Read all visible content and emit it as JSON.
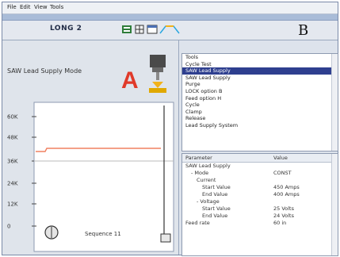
{
  "menu": [
    "File",
    "Edit",
    "View",
    "Tools"
  ],
  "toolbar": {
    "device_label": "LONG 2"
  },
  "callouts": {
    "a": "A",
    "b": "B"
  },
  "device_name": "SAW Lead Supply Mode",
  "chart_data": {
    "type": "line",
    "y_tick_labels": [
      "60K",
      "48K",
      "36K",
      "24K",
      "12K",
      "0"
    ],
    "status_text": "Sequence 11",
    "series_color": "#f08060"
  },
  "tree": {
    "items": [
      {
        "label": "Tools"
      },
      {
        "label": "Cycle Test"
      },
      {
        "label": "SAW Lead Supply",
        "selected": true
      },
      {
        "label": "SAW Lead Supply"
      },
      {
        "label": "Purge"
      },
      {
        "label": "LOCK option B"
      },
      {
        "label": "Feed option H"
      },
      {
        "label": "Cycle"
      },
      {
        "label": "Clamp"
      },
      {
        "label": "Release"
      },
      {
        "label": "Lead Supply System"
      }
    ]
  },
  "props": {
    "columns": [
      "Parameter",
      "Value"
    ],
    "rows": [
      {
        "name": "SAW Lead Supply",
        "value": "",
        "level": 0
      },
      {
        "name": "- Mode",
        "value": "CONST",
        "level": 1
      },
      {
        "name": "Current",
        "value": "",
        "level": 2
      },
      {
        "name": "Start Value",
        "value": "450 Amps",
        "level": 3
      },
      {
        "name": "End Value",
        "value": "400 Amps",
        "level": 3
      },
      {
        "name": "- Voltage",
        "value": "",
        "level": 2
      },
      {
        "name": "Start Value",
        "value": "25 Volts",
        "level": 3
      },
      {
        "name": "End Value",
        "value": "24 Volts",
        "level": 3
      },
      {
        "name": "Feed rate",
        "value": "60 in",
        "level": 0
      }
    ]
  }
}
